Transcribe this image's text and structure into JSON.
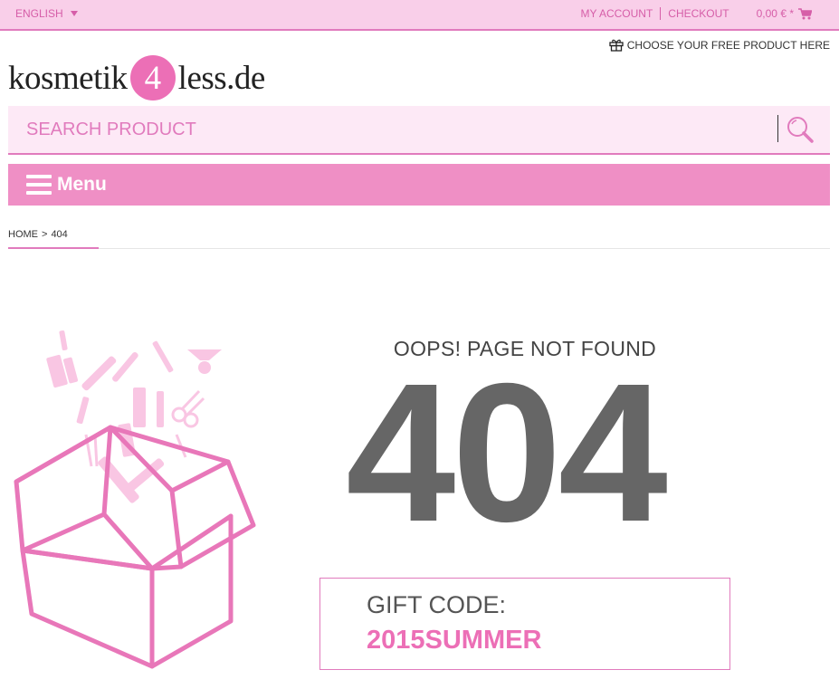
{
  "topbar": {
    "language": "ENGLISH",
    "my_account": "MY ACCOUNT",
    "checkout": "CHECKOUT",
    "cart_total": "0,00 € *"
  },
  "header": {
    "free_product": "CHOOSE YOUR FREE PRODUCT HERE",
    "logo_left": "kosmetik",
    "logo_number": "4",
    "logo_right": "less.de"
  },
  "search": {
    "placeholder": "SEARCH PRODUCT"
  },
  "menu": {
    "label": "Menu"
  },
  "breadcrumb": {
    "home": "HOME",
    "separator": ">",
    "current": "404"
  },
  "error": {
    "heading": "OOPS! PAGE NOT FOUND",
    "code": "404",
    "gift_label": "GIFT CODE:",
    "gift_code": "2015SUMMER"
  },
  "colors": {
    "brand_pink": "#ec6fb6",
    "topbar_bg": "#f9cfe9",
    "menu_bg": "#ef8fc5",
    "search_bg": "#fde9f6"
  },
  "icons": {
    "cart": "cart-icon",
    "gift": "gift-icon",
    "search": "magnifier-icon",
    "menu": "hamburger-icon"
  }
}
